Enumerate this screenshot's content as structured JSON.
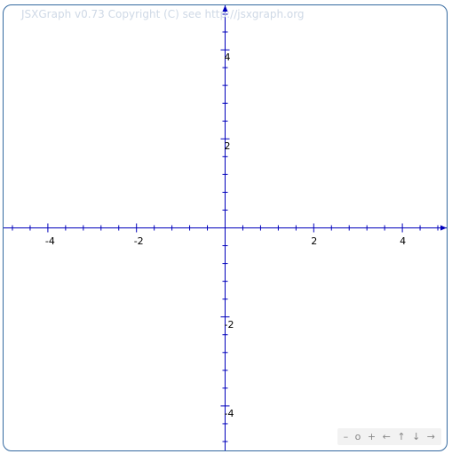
{
  "board": {
    "copyright": "JSXGraph v0.73 Copyright (C) see http://jsxgraph.org",
    "colors": {
      "border": "#356aa0",
      "axis": "#0000bb",
      "copyright": "#cfd9e6",
      "background": "#ffffff"
    }
  },
  "chart_data": {
    "type": "scatter",
    "x_range": [
      -5,
      5
    ],
    "y_range": [
      -5,
      5
    ],
    "x_tick_labels": [
      "-4",
      "-2",
      "2",
      "4"
    ],
    "y_tick_labels": [
      "4",
      "2",
      "-2",
      "-4"
    ],
    "major_ticks": [
      -4,
      -2,
      2,
      4
    ],
    "minor_tick_step": 0.4,
    "grid": false,
    "series": []
  },
  "navbar": {
    "zoom_out": "–",
    "zoom_reset": "o",
    "zoom_in": "+",
    "left": "←",
    "up": "↑",
    "down": "↓",
    "right": "→"
  }
}
